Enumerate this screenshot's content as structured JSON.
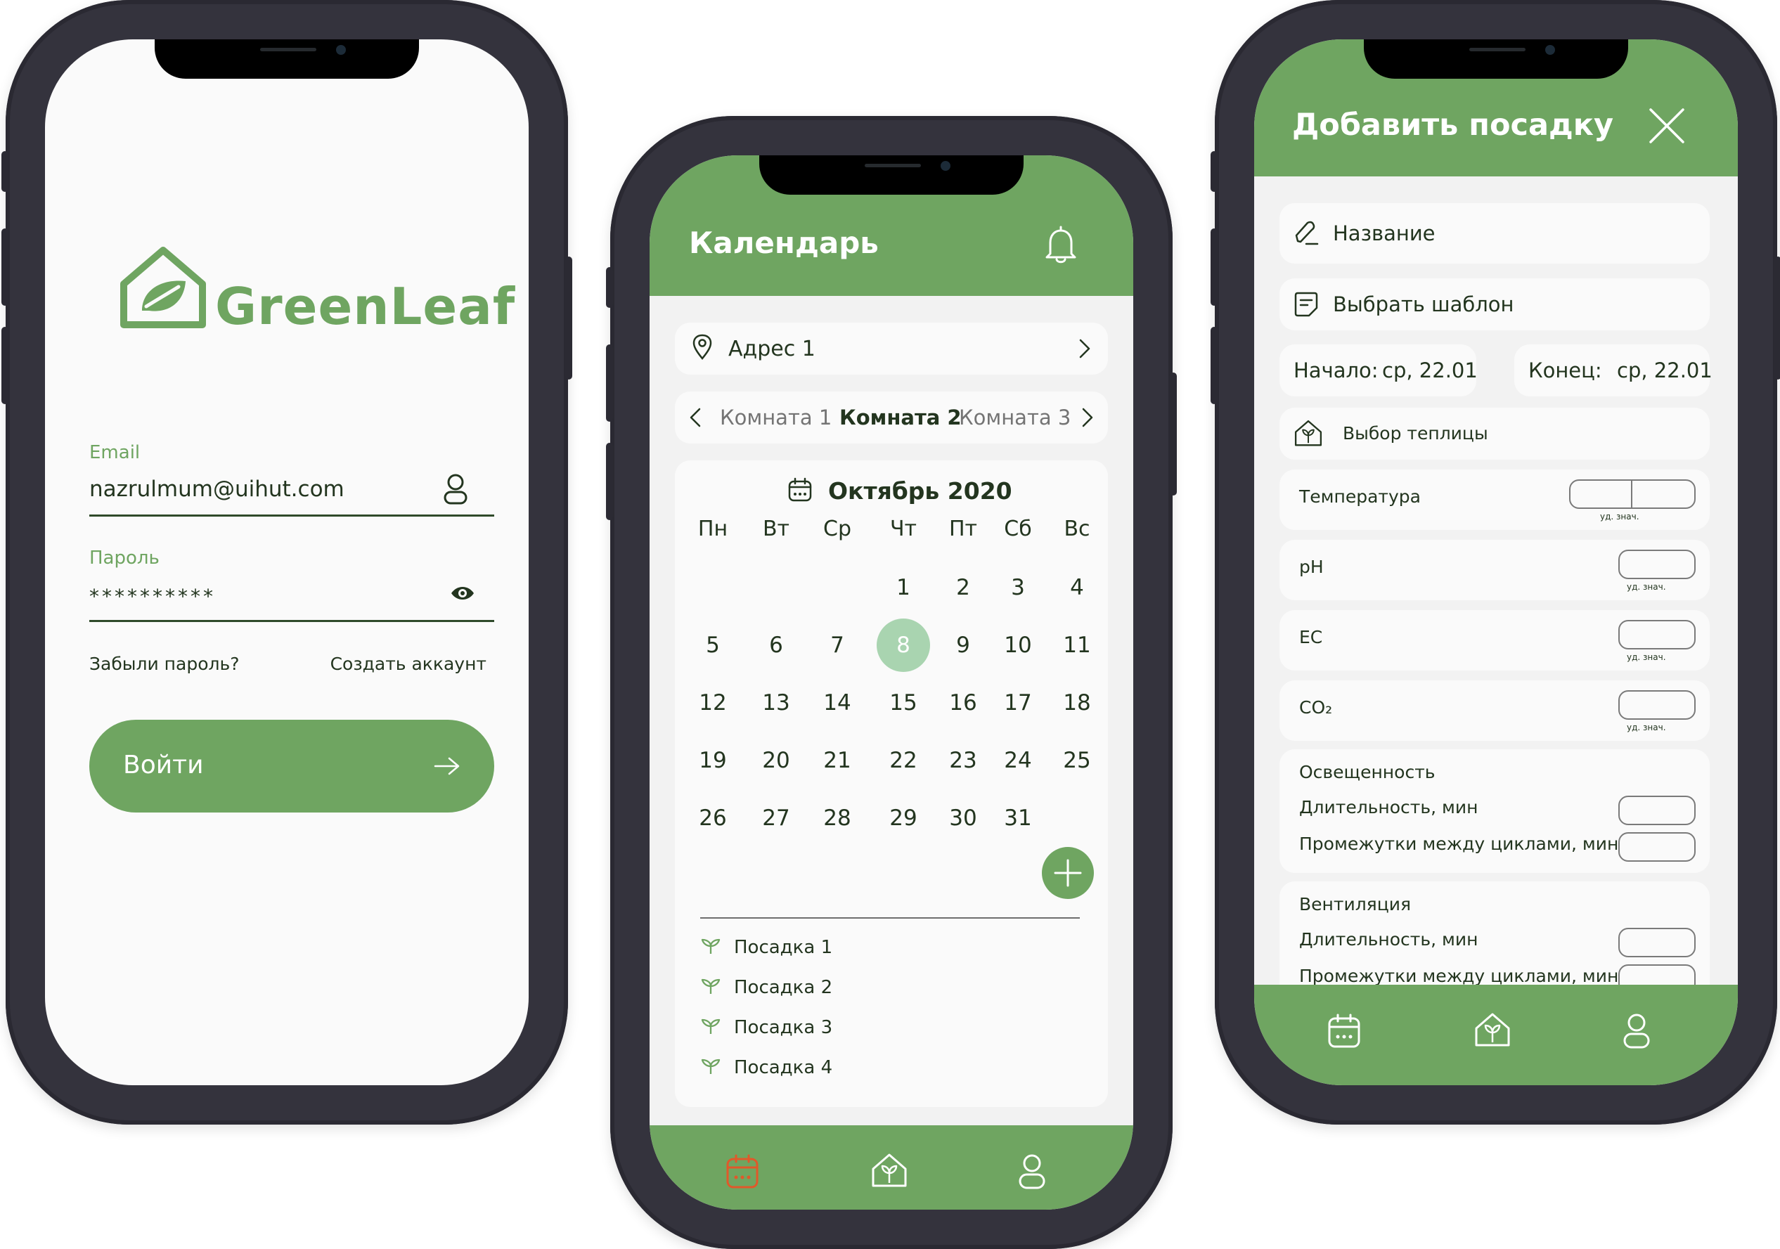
{
  "colors": {
    "primary": "#6fa561",
    "accent": "#e0592a",
    "today": "#a9d4b0",
    "frame": "#34333d",
    "text": "#23351f"
  },
  "login": {
    "logo_text": "GreenLeaf",
    "email_label": "Email",
    "email_value": "nazrulmum@uihut.com",
    "password_label": "Пароль",
    "password_value": "**********",
    "forgot_link": "Забыли пароль?",
    "create_link": "Создать аккаунт",
    "login_button": "Войти"
  },
  "calendar": {
    "title": "Календарь",
    "address": "Адрес 1",
    "rooms": [
      "Комната 1",
      "Комната 2",
      "Комната 3"
    ],
    "selected_room": "Комната 2",
    "month": "Октябрь 2020",
    "weekdays": [
      "Пн",
      "Вт",
      "Ср",
      "Чт",
      "Пт",
      "Сб",
      "Вс"
    ],
    "weeks": [
      [
        "",
        "",
        "",
        "1",
        "2",
        "3",
        "4"
      ],
      [
        "5",
        "6",
        "7",
        "8",
        "9",
        "10",
        "11"
      ],
      [
        "12",
        "13",
        "14",
        "15",
        "16",
        "17",
        "18"
      ],
      [
        "19",
        "20",
        "21",
        "22",
        "23",
        "24",
        "25"
      ],
      [
        "26",
        "27",
        "28",
        "29",
        "30",
        "31",
        ""
      ]
    ],
    "today": "8",
    "plantings": [
      "Посадка 1",
      "Посадка 2",
      "Посадка 3",
      "Посадка 4"
    ],
    "nav": [
      {
        "icon": "calendar-icon",
        "active": true
      },
      {
        "icon": "greenhouse-icon",
        "active": false
      },
      {
        "icon": "profile-icon",
        "active": false
      }
    ]
  },
  "add_planting": {
    "title": "Добавить посадку",
    "name_field": "Название",
    "template_field": "Выбрать шаблон",
    "start_label": "Начало:",
    "start_value": "ср, 22.01",
    "end_label": "Конец:",
    "end_value": "ср, 22.01",
    "greenhouse_field": "Выбор теплицы",
    "params": [
      {
        "label": "Температура",
        "unit": "уд. знач."
      },
      {
        "label": "pH",
        "unit": "уд. знач."
      },
      {
        "label": "EC",
        "unit": "уд. знач."
      },
      {
        "label": "CO₂",
        "unit": "уд. знач."
      }
    ],
    "lighting": {
      "title": "Освещенность",
      "duration": "Длительность, мин",
      "interval": "Промежутки между циклами, мин"
    },
    "ventilation": {
      "title": "Вентиляция",
      "duration": "Длительность, мин",
      "interval": "Промежутки между циклами, мин"
    },
    "nav": [
      {
        "icon": "calendar-icon",
        "active": false
      },
      {
        "icon": "greenhouse-icon",
        "active": false
      },
      {
        "icon": "profile-icon",
        "active": false
      }
    ]
  }
}
